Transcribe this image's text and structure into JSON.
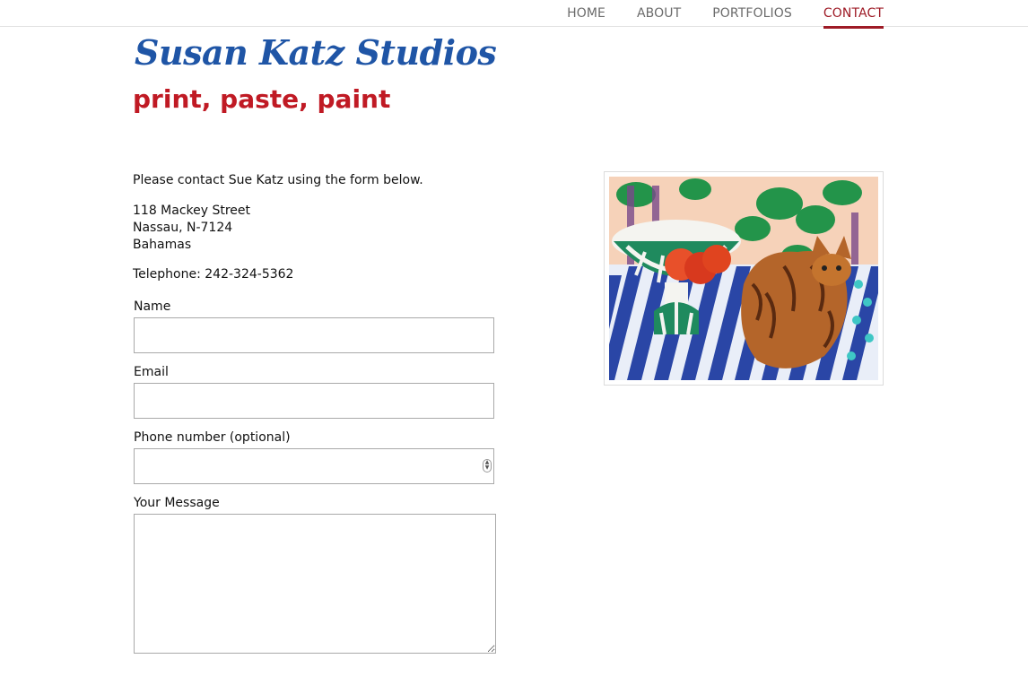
{
  "nav": {
    "items": [
      {
        "label": "HOME"
      },
      {
        "label": "ABOUT"
      },
      {
        "label": "PORTFOLIOS"
      },
      {
        "label": "CONTACT",
        "active": true
      }
    ]
  },
  "header": {
    "brand": "Susan Katz Studios",
    "tagline": "print, paste, paint"
  },
  "contact": {
    "intro": "Please contact Sue Katz using the form below.",
    "address_lines": [
      "118 Mackey Street",
      "Nassau, N-7124",
      "Bahamas"
    ],
    "telephone": "Telephone: 242-324-5362"
  },
  "form": {
    "name_label": "Name",
    "name_value": "",
    "email_label": "Email",
    "email_value": "",
    "phone_label": "Phone number (optional)",
    "phone_value": "",
    "message_label": "Your Message",
    "message_value": ""
  },
  "colors": {
    "brand_blue": "#1f55a6",
    "tagline_red": "#c01a24",
    "nav_active": "#9e1b26",
    "nav_text": "#6b6b6b"
  }
}
